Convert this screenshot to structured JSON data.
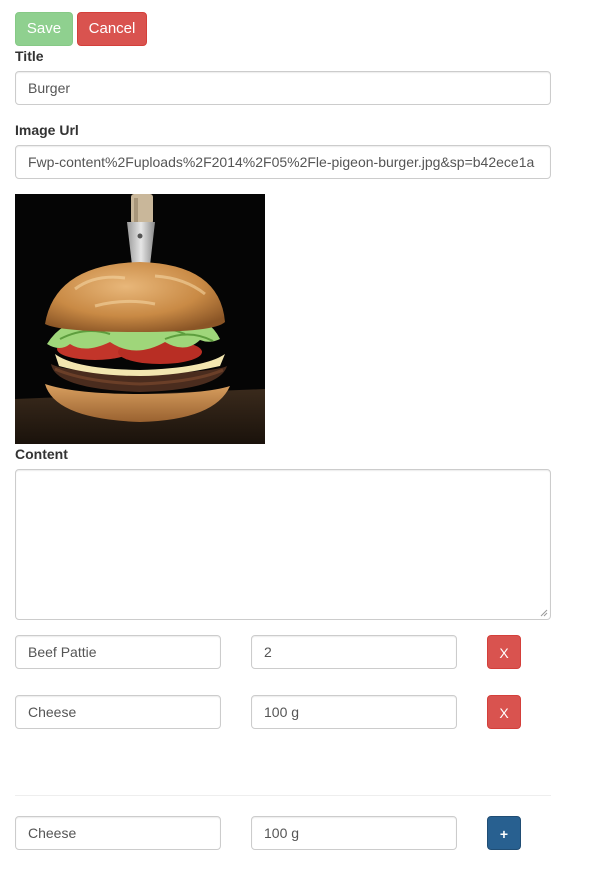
{
  "toolbar": {
    "save_label": "Save",
    "cancel_label": "Cancel"
  },
  "title_field": {
    "label": "Title",
    "value": "Burger"
  },
  "image_url_field": {
    "label": "Image Url",
    "value": "Fwp-content%2Fuploads%2F2014%2F05%2Fle-pigeon-burger.jpg&sp=b42ece1a"
  },
  "image_preview": {
    "subject": "burger-photo"
  },
  "content_field": {
    "label": "Content",
    "value": ""
  },
  "ingredients": [
    {
      "name": "Beef Pattie",
      "quantity": "2",
      "remove_label": "X"
    },
    {
      "name": "Cheese",
      "quantity": "100 g",
      "remove_label": "X"
    }
  ],
  "new_ingredient": {
    "name": "Cheese",
    "quantity": "100 g",
    "add_label": "+"
  },
  "colors": {
    "save": "#8fd08f",
    "danger": "#d9534f",
    "primary": "#286090"
  }
}
